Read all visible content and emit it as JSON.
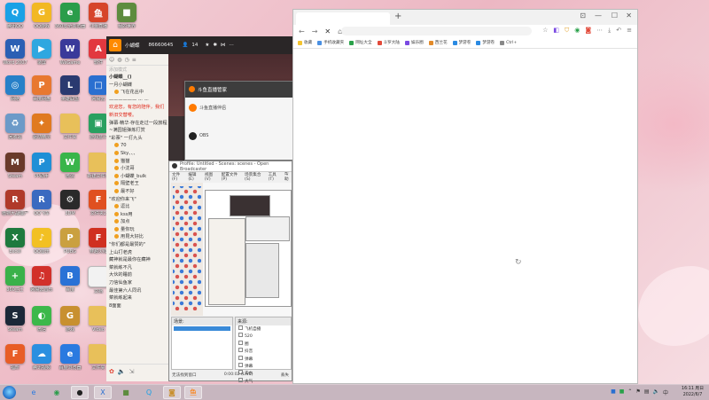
{
  "desktop_icons": [
    {
      "label": "腾讯QQ",
      "icon": "qq-icon",
      "color": "#1aa1e6",
      "glyph": "Q"
    },
    {
      "label": "QQ游戏",
      "icon": "qq-game-icon",
      "color": "#f2b823",
      "glyph": "G"
    },
    {
      "label": "360安全浏览器",
      "icon": "browser-icon",
      "color": "#2a9d4a",
      "glyph": "e"
    },
    {
      "label": "斗鱼直播",
      "icon": "douyu-icon",
      "color": "#d6452a",
      "glyph": "鱼"
    },
    {
      "label": "我的世界",
      "icon": "minecraft-icon",
      "color": "#5d8c3e",
      "glyph": "■"
    },
    {
      "label": "Word 2007",
      "icon": "word-icon",
      "color": "#2b5fb4",
      "glyph": "W"
    },
    {
      "label": "录屏",
      "icon": "record-icon",
      "color": "#2fa7e0",
      "glyph": "▶"
    },
    {
      "label": "WeGame",
      "icon": "wegame-icon",
      "color": "#3a3a9a",
      "glyph": "W"
    },
    {
      "label": "软件",
      "icon": "app-icon",
      "color": "#e2383f",
      "glyph": "A"
    },
    {
      "label": "网络",
      "icon": "network-icon",
      "color": "#2780c8",
      "glyph": "◎"
    },
    {
      "label": "百度网盘",
      "icon": "game2-icon",
      "color": "#e87830",
      "glyph": "P"
    },
    {
      "label": "英雄联盟",
      "icon": "lol-icon",
      "color": "#2a3a70",
      "glyph": "L"
    },
    {
      "label": "网易云",
      "icon": "screen-icon",
      "color": "#2a6fd0",
      "glyph": "□"
    },
    {
      "label": "回收站",
      "icon": "recycle-bin-icon",
      "color": "#6c9ac8",
      "glyph": "♻"
    },
    {
      "label": "驱动精灵",
      "icon": "gift-icon",
      "color": "#e07a20",
      "glyph": "✦"
    },
    {
      "label": "文件夹",
      "icon": "folder-icon",
      "color": "#e8c05a",
      "glyph": ""
    },
    {
      "label": "游戏盒子",
      "icon": "gamebox-icon",
      "color": "#2aa060",
      "glyph": "▣"
    },
    {
      "label": "迅雷",
      "icon": "xunlei-icon",
      "color": "#2a7ae0",
      "glyph": "X"
    },
    {
      "label": "Steam",
      "icon": "monster-icon",
      "color": "#6a3a2a",
      "glyph": "M"
    },
    {
      "label": "PP助手",
      "icon": "pp-icon",
      "color": "#1f8fd6",
      "glyph": "P"
    },
    {
      "label": "微信",
      "icon": "wechat-icon",
      "color": "#39b54a",
      "glyph": "W"
    },
    {
      "label": "新建文件夹",
      "icon": "folder-icon",
      "color": "#e8c05a",
      "glyph": ""
    },
    {
      "label": "植物大战僵尸",
      "icon": "robot-icon",
      "color": "#b03a2a",
      "glyph": "R"
    },
    {
      "label": "QQ飞车",
      "icon": "race-icon",
      "color": "#3a6ac0",
      "glyph": "R"
    },
    {
      "label": "3DM",
      "icon": "gear-icon",
      "color": "#2a2a2a",
      "glyph": "⚙"
    },
    {
      "label": "文件夹2",
      "icon": "fire-icon",
      "color": "#e05020",
      "glyph": "F"
    },
    {
      "label": "Excel",
      "icon": "excel-icon",
      "color": "#1e7a3e",
      "glyph": "X"
    },
    {
      "label": "QQ音乐",
      "icon": "qq-music-icon",
      "color": "#f2c023",
      "glyph": "♪"
    },
    {
      "label": "PUBG",
      "icon": "pubg-icon",
      "color": "#caa040",
      "glyph": "P"
    },
    {
      "label": "穿越火线",
      "icon": "cf-icon",
      "color": "#d03020",
      "glyph": "F"
    },
    {
      "label": "360卫士",
      "icon": "shield-icon",
      "color": "#3ab14a",
      "glyph": "+"
    },
    {
      "label": "网易云音乐",
      "icon": "netease-icon",
      "color": "#d2302a",
      "glyph": "♫"
    },
    {
      "label": "百度",
      "icon": "baidu-icon",
      "color": "#2a72d6",
      "glyph": "B"
    },
    {
      "label": "文档",
      "icon": "doc-icon",
      "color": "#f2f2f2",
      "glyph": ""
    },
    {
      "label": "Steam",
      "icon": "steam-icon",
      "color": "#1b2838",
      "glyph": "S"
    },
    {
      "label": "微信",
      "icon": "chat-icon",
      "color": "#3cb84a",
      "glyph": "◐"
    },
    {
      "label": "游戏",
      "icon": "game3-icon",
      "color": "#c89030",
      "glyph": "G"
    },
    {
      "label": "Video",
      "icon": "folder-icon",
      "color": "#e8c05a",
      "glyph": ""
    },
    {
      "label": "福昕",
      "icon": "foxit-icon",
      "color": "#e85d26",
      "glyph": "F"
    },
    {
      "label": "腾讯视频",
      "icon": "cloud-icon",
      "color": "#2a8fe0",
      "glyph": "☁"
    },
    {
      "label": "百度浏览器",
      "icon": "browser2-icon",
      "color": "#2a7ae0",
      "glyph": "e"
    },
    {
      "label": "文件夹",
      "icon": "folder-icon",
      "color": "#e8c05a",
      "glyph": ""
    }
  ],
  "room": {
    "username": "小蝴蝶",
    "room_id": "86660645",
    "viewers": "14",
    "chat_header": "添加模式",
    "chat_hint": "输入您想说的话",
    "chat_lines": [
      {
        "text": "小蝴蝶__()",
        "style": "bold"
      },
      {
        "text": "一月小蝴蝶",
        "style": ""
      },
      {
        "text": "飞在花丛中",
        "style": "user"
      },
      {
        "text": "——————  ·-·  ·-·",
        "style": ""
      },
      {
        "text": "欢迎您，有您的陪伴，我们",
        "style": "red"
      },
      {
        "text": "新旧交替喽。",
        "style": "red"
      },
      {
        "text": "弹幕·精华·存在走过一段旅程",
        "style": ""
      },
      {
        "text": "~满园姐弹炼打赏",
        "style": ""
      },
      {
        "text": "\"彩票\" 一打九头",
        "style": ""
      },
      {
        "text": "70",
        "style": "user"
      },
      {
        "text": "Sky、、、",
        "style": "user"
      },
      {
        "text": "猫猫",
        "style": "user"
      },
      {
        "text": "小沈哥",
        "style": "user"
      },
      {
        "text": "小蝴蝶_bulk",
        "style": "user"
      },
      {
        "text": "隔壁老王",
        "style": "user"
      },
      {
        "text": "最不好",
        "style": "user"
      },
      {
        "text": "\"欢迎你来飞\"",
        "style": ""
      },
      {
        "text": "逗比",
        "style": "user"
      },
      {
        "text": "kss用",
        "style": "user"
      },
      {
        "text": "加点",
        "style": "user"
      },
      {
        "text": "量你玩",
        "style": "user"
      },
      {
        "text": "用昆大好比",
        "style": "user"
      },
      {
        "text": "\"你们都是最赞的\"",
        "style": ""
      },
      {
        "text": "上山打老虎",
        "style": ""
      },
      {
        "text": "藏神就是最你在藏神",
        "style": ""
      },
      {
        "text": "菜就练不凡",
        "style": ""
      },
      {
        "text": "大伙的睡前",
        "style": ""
      },
      {
        "text": "刀信仙鱼家",
        "style": ""
      },
      {
        "text": "最佳第六人同讯",
        "style": ""
      },
      {
        "text": "菜就练起来",
        "style": ""
      },
      {
        "text": "8面面",
        "style": ""
      }
    ]
  },
  "assistant": {
    "title": "斗鱼直播管家",
    "row1": "斗鱼直播伴侣",
    "row2": "OBS"
  },
  "obs": {
    "title": "Profile: Untitled - Scenes: scenes - Open Broadcaster",
    "menu": [
      "文件(F)",
      "编辑(E)",
      "视图(V)",
      "配置文件(P)",
      "场景集合(S)",
      "工具(T)",
      "帮助"
    ],
    "scenes_label": "场景:",
    "sources_label": "来源:",
    "sources": [
      "飞机自播",
      "520",
      "圈",
      "抖音",
      "弹幕",
      "弹幕",
      "去水",
      "大气"
    ],
    "status_left": "无法找到窗口",
    "status_mid": "0:00:02 (LIVE)",
    "status_right": "丢失"
  },
  "browser": {
    "bookmarks": [
      {
        "label": "收藏",
        "color": "#f4c430"
      },
      {
        "label": "手机收藏夹",
        "color": "#4a90e2"
      },
      {
        "label": "网址大全",
        "color": "#2aa14a"
      },
      {
        "label": "斗罗大陆",
        "color": "#e24a3a"
      },
      {
        "label": "娱乐圈",
        "color": "#7a4ae2"
      },
      {
        "label": "西兰花",
        "color": "#e28a2a"
      },
      {
        "label": "梦游卷",
        "color": "#2a8ae2"
      },
      {
        "label": "梦游卷",
        "color": "#2a8ae2"
      },
      {
        "label": "Ctrl+",
        "color": "#888888"
      }
    ]
  },
  "taskbar": {
    "apps": [
      {
        "icon": "ie-icon",
        "glyph": "e",
        "color": "#2a7ae0",
        "active": false
      },
      {
        "icon": "browser-icon",
        "glyph": "◉",
        "color": "#2a9d4a",
        "active": false
      },
      {
        "icon": "obs-icon",
        "glyph": "●",
        "color": "#222222",
        "active": true
      },
      {
        "icon": "app-icon",
        "glyph": "X",
        "color": "#2a6fd0",
        "active": true
      },
      {
        "icon": "minecraft-icon",
        "glyph": "■",
        "color": "#5d8c3e",
        "active": false
      },
      {
        "icon": "qq-icon",
        "glyph": "Q",
        "color": "#1aa1e6",
        "active": false
      },
      {
        "icon": "game-icon",
        "glyph": "◙",
        "color": "#c89030",
        "active": true
      },
      {
        "icon": "douyu-icon",
        "glyph": "鱼",
        "color": "#ff7a00",
        "active": true
      }
    ],
    "time": "16:11 周日",
    "date": "2022/6/7"
  }
}
